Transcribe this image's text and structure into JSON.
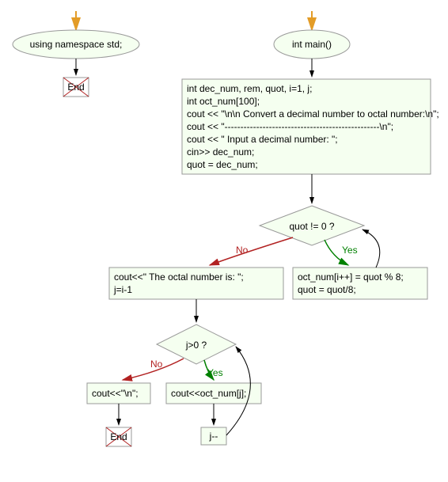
{
  "nodes": {
    "ns_ellipse": "using namespace std;",
    "end1": "End",
    "main_ellipse": "int main()",
    "block1_lines": [
      "int dec_num, rem, quot, i=1, j;",
      "int oct_num[100];",
      "cout << \"\\n\\n Convert a  decimal number to octal number:\\n\";",
      "cout << \"-------------------------------------------------\\n\";",
      "cout << \" Input a decimal number: \";",
      "cin>> dec_num;",
      "quot = dec_num;"
    ],
    "decision1": "quot != 0 ?",
    "block_yes1_lines": [
      "oct_num[i++] = quot % 8;",
      "quot = quot/8;"
    ],
    "block_no1_lines": [
      "cout<<\" The octal number is: \";",
      "j=i-1"
    ],
    "decision2": "j>0 ?",
    "block_yes2": "cout<<oct_num[j];",
    "block_no2": "cout<<\"\\n\";",
    "jdec": "j--",
    "end2": "End",
    "labels": {
      "yes": "Yes",
      "no": "No"
    }
  },
  "colors": {
    "yes": "#008000",
    "no": "#b22222",
    "arrow_orange": "#e39c27",
    "box_bg": "#f5fff0",
    "box_border": "#999"
  }
}
